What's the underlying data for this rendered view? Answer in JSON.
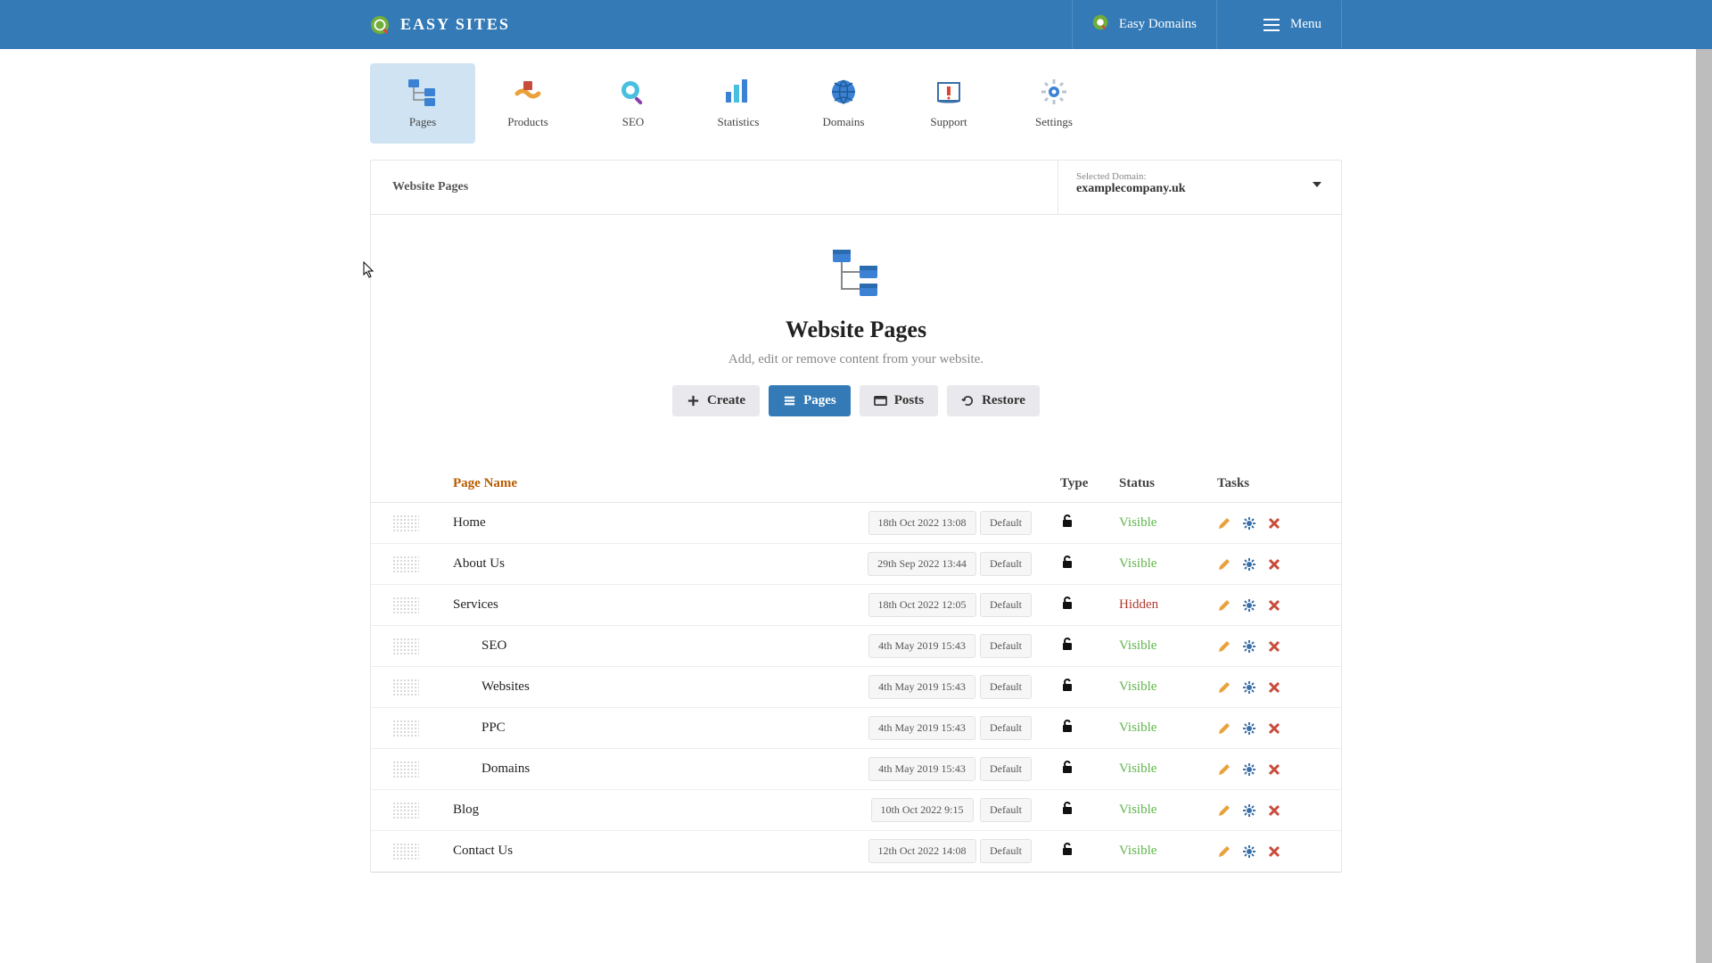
{
  "header": {
    "brand": "EASY SITES",
    "links": [
      {
        "label": "Easy Domains"
      },
      {
        "label": "Menu"
      }
    ]
  },
  "tabs": [
    {
      "label": "Pages",
      "active": true
    },
    {
      "label": "Products"
    },
    {
      "label": "SEO"
    },
    {
      "label": "Statistics"
    },
    {
      "label": "Domains"
    },
    {
      "label": "Support"
    },
    {
      "label": "Settings"
    }
  ],
  "breadcrumb": "Website Pages",
  "domain": {
    "label": "Selected Domain:",
    "value": "examplecompany.uk"
  },
  "hero": {
    "title": "Website Pages",
    "subtitle": "Add, edit or remove content from your website."
  },
  "actions": {
    "create": "Create",
    "pages": "Pages",
    "posts": "Posts",
    "restore": "Restore"
  },
  "columns": {
    "name": "Page Name",
    "type": "Type",
    "status": "Status",
    "tasks": "Tasks"
  },
  "status_labels": {
    "visible": "Visible",
    "hidden": "Hidden"
  },
  "template_label": "Default",
  "rows": [
    {
      "name": "Home",
      "date": "18th Oct 2022 13:08",
      "status": "visible",
      "indent": false
    },
    {
      "name": "About Us",
      "date": "29th Sep 2022 13:44",
      "status": "visible",
      "indent": false
    },
    {
      "name": "Services",
      "date": "18th Oct 2022 12:05",
      "status": "hidden",
      "indent": false
    },
    {
      "name": "SEO",
      "date": "4th May 2019 15:43",
      "status": "visible",
      "indent": true
    },
    {
      "name": "Websites",
      "date": "4th May 2019 15:43",
      "status": "visible",
      "indent": true
    },
    {
      "name": "PPC",
      "date": "4th May 2019 15:43",
      "status": "visible",
      "indent": true
    },
    {
      "name": "Domains",
      "date": "4th May 2019 15:43",
      "status": "visible",
      "indent": true
    },
    {
      "name": "Blog",
      "date": "10th Oct 2022 9:15",
      "status": "visible",
      "indent": false
    },
    {
      "name": "Contact Us",
      "date": "12th Oct 2022 14:08",
      "status": "visible",
      "indent": false
    }
  ]
}
